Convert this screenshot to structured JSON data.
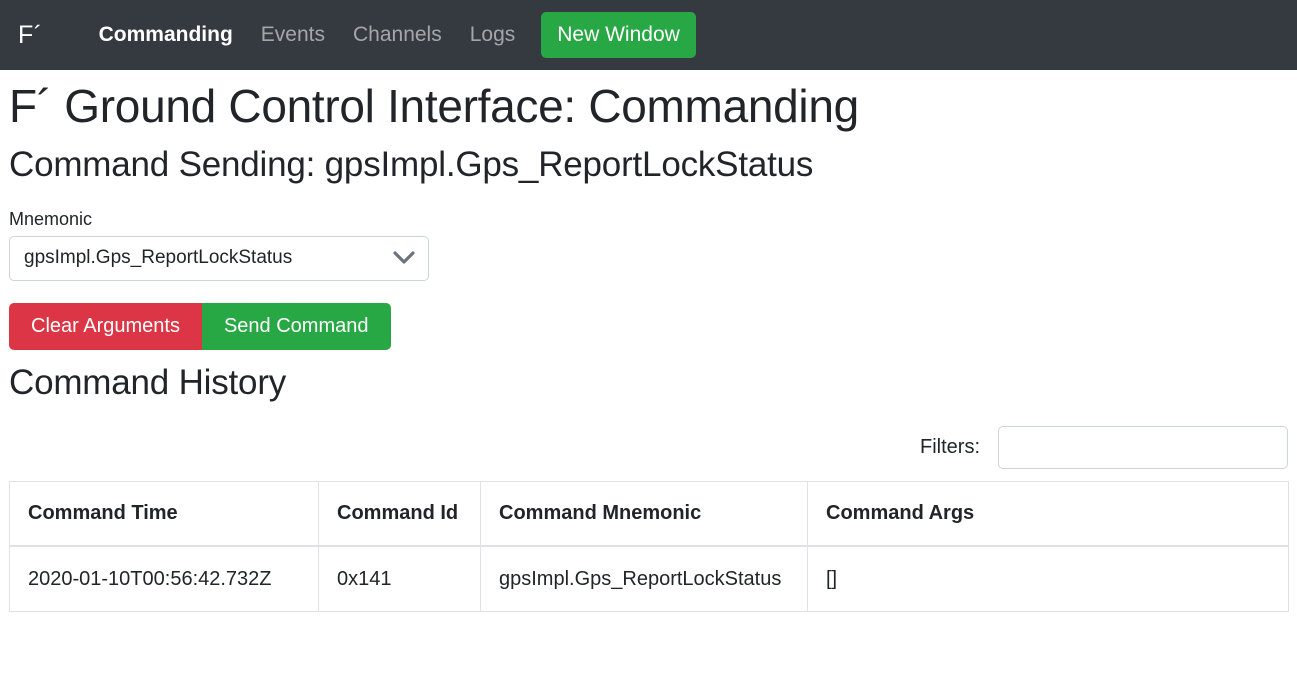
{
  "navbar": {
    "brand": "F´",
    "links": [
      {
        "label": "Commanding",
        "active": true
      },
      {
        "label": "Events",
        "active": false
      },
      {
        "label": "Channels",
        "active": false
      },
      {
        "label": "Logs",
        "active": false
      }
    ],
    "new_window_label": "New Window",
    "background_color": "#343a40",
    "accent_color": "#28a745"
  },
  "page": {
    "title": "F´ Ground Control Interface: Commanding",
    "subtitle": "Command Sending: gpsImpl.Gps_ReportLockStatus"
  },
  "form": {
    "mnemonic_label": "Mnemonic",
    "mnemonic_value": "gpsImpl.Gps_ReportLockStatus",
    "dropdown_icon": "chevron-down-icon",
    "clear_button_label": "Clear Arguments",
    "send_button_label": "Send Command",
    "clear_button_color": "#dc3545",
    "send_button_color": "#28a745"
  },
  "history": {
    "title": "Command History",
    "filter_label": "Filters:",
    "filter_value": "",
    "filter_placeholder": "",
    "columns": [
      "Command Time",
      "Command Id",
      "Command Mnemonic",
      "Command Args"
    ],
    "rows": [
      {
        "time": "2020-01-10T00:56:42.732Z",
        "id": "0x141",
        "mnemonic": "gpsImpl.Gps_ReportLockStatus",
        "args": "[]"
      }
    ]
  }
}
